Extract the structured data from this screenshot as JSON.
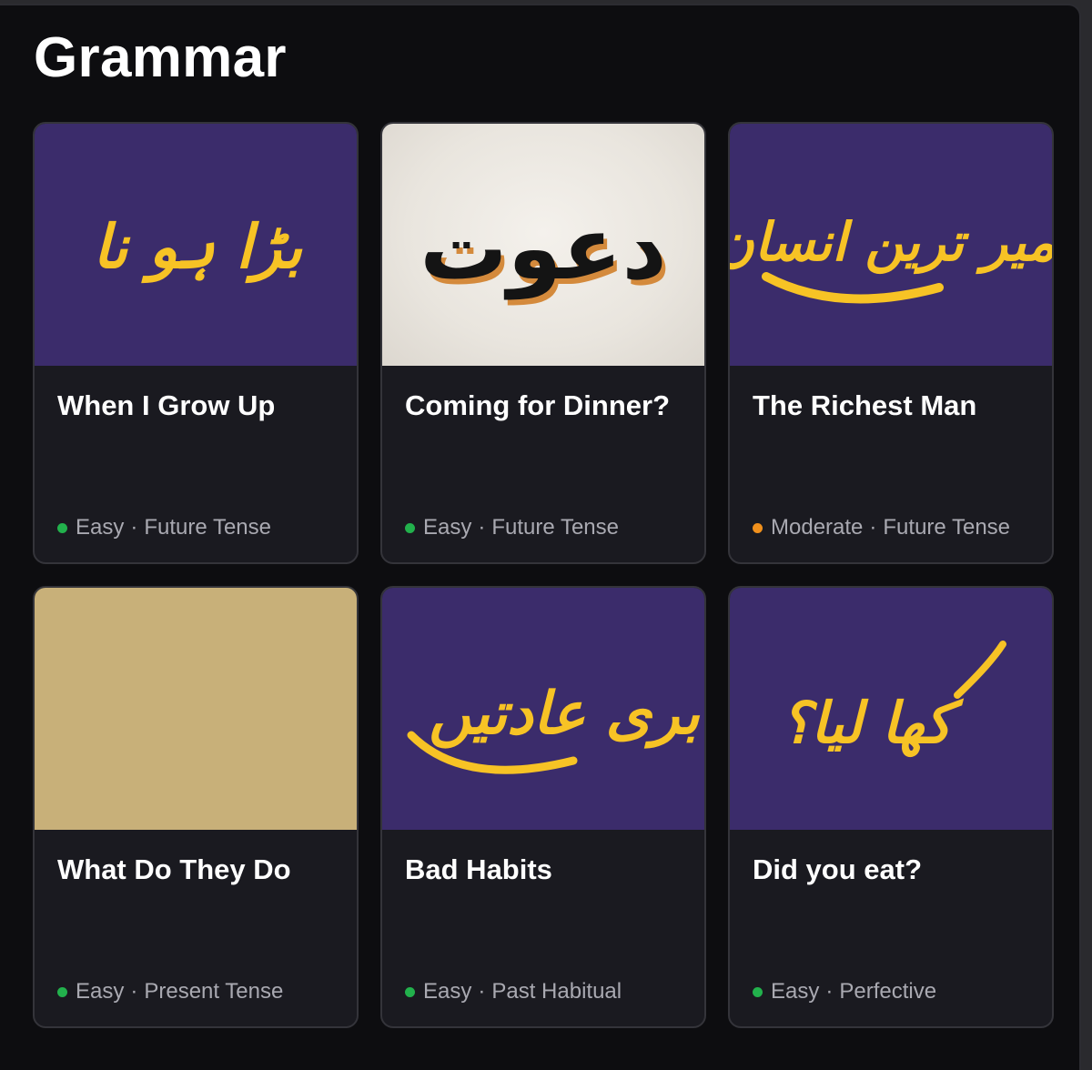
{
  "section": {
    "title": "Grammar"
  },
  "colors": {
    "easy": "#22b14c",
    "moderate": "#f0901c",
    "urdu_text": "#f7c325",
    "purple_bg": "#3b2c6b"
  },
  "cards": [
    {
      "title": "When I Grow Up",
      "difficulty": "Easy",
      "difficulty_color": "#22b14c",
      "topic": "Future Tense",
      "image_text": "بڑا ہو نا"
    },
    {
      "title": "Coming for Dinner?",
      "difficulty": "Easy",
      "difficulty_color": "#22b14c",
      "topic": "Future Tense",
      "image_text": "دعوت"
    },
    {
      "title": "The Richest Man",
      "difficulty": "Moderate",
      "difficulty_color": "#f0901c",
      "topic": "Future Tense",
      "image_text": "امیر ترین انسان"
    },
    {
      "title": "What Do They Do",
      "difficulty": "Easy",
      "difficulty_color": "#22b14c",
      "topic": "Present Tense",
      "image_text": ""
    },
    {
      "title": "Bad Habits",
      "difficulty": "Easy",
      "difficulty_color": "#22b14c",
      "topic": "Past Habitual",
      "image_text": "بری عادتیں"
    },
    {
      "title": "Did you eat?",
      "difficulty": "Easy",
      "difficulty_color": "#22b14c",
      "topic": "Perfective",
      "image_text": "کھا لیا؟"
    }
  ]
}
